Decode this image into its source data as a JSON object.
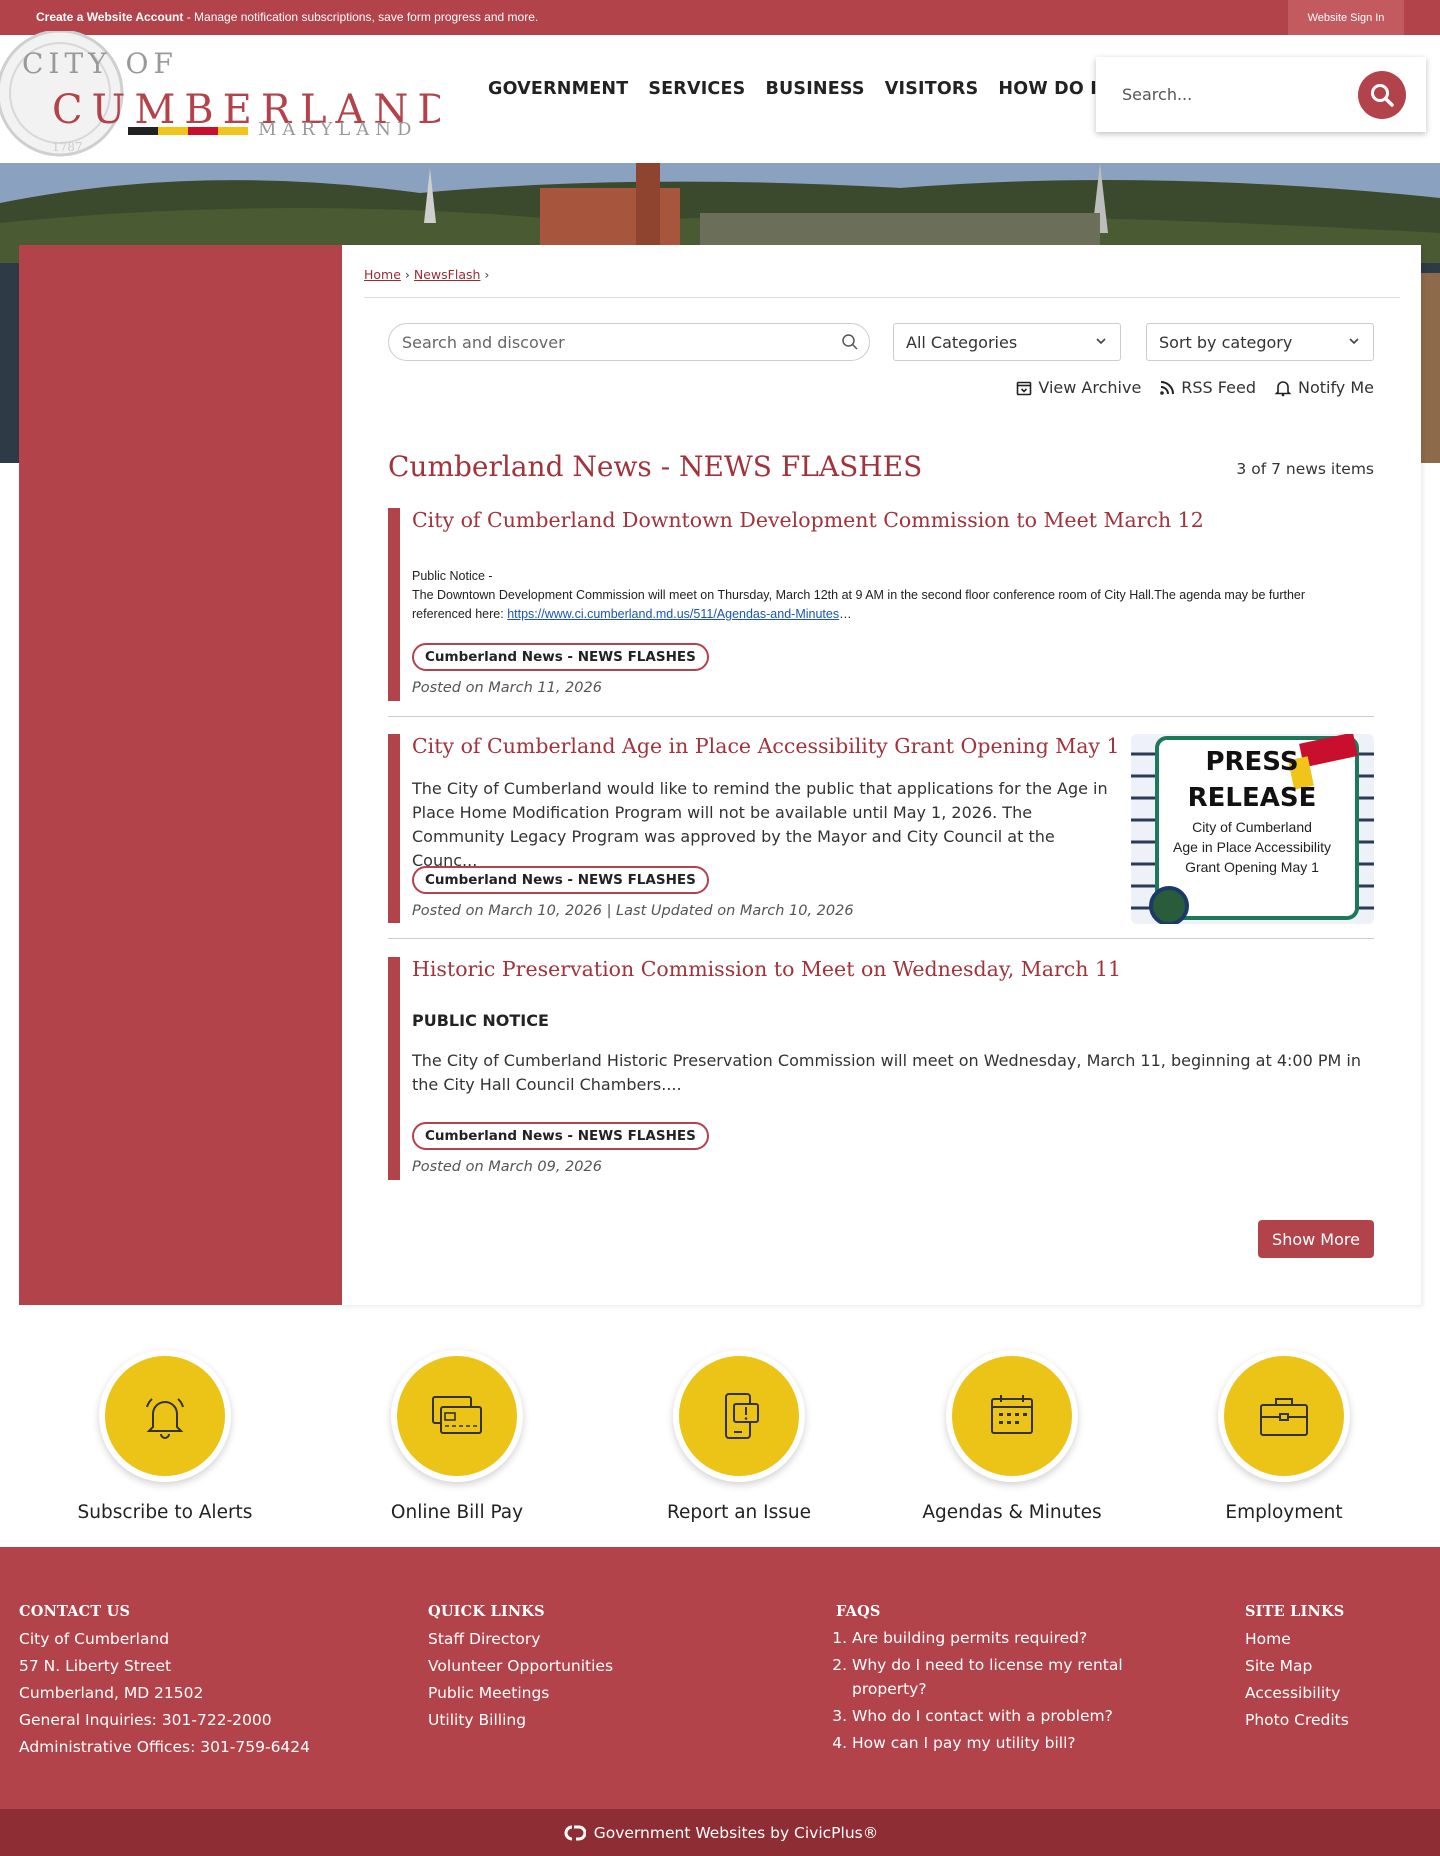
{
  "topbar": {
    "create_account": "Create a Website Account",
    "create_desc": " - Manage notification subscriptions, save form progress and more.",
    "sign_in": "Website Sign In"
  },
  "logo": {
    "city_of": "CITY OF",
    "cumberland": "CUMBERLAND",
    "maryland": "MARYLAND",
    "seal_year": "1787"
  },
  "nav": [
    "GOVERNMENT",
    "SERVICES",
    "BUSINESS",
    "VISITORS",
    "HOW DO I..."
  ],
  "search": {
    "placeholder": "Search..."
  },
  "breadcrumb": {
    "home": "Home",
    "newsflash": "NewsFlash"
  },
  "filters": {
    "search_placeholder": "Search and discover",
    "categories": "All Categories",
    "sort": "Sort by category"
  },
  "tools": {
    "archive": "View Archive",
    "rss": "RSS Feed",
    "notify": "Notify Me"
  },
  "section": {
    "title": "Cumberland News - NEWS FLASHES",
    "count": "3 of 7 news items"
  },
  "items": [
    {
      "title": "City of Cumberland Downtown Development Commission to Meet March 12",
      "line1": "Public Notice -",
      "line2": "The Downtown Development Commission will meet on Thursday, March 12th at 9 AM in the second floor conference room of City Hall.The agenda may be further",
      "line3_pre": "referenced here: ",
      "link": "https://www.ci.cumberland.md.us/511/Agendas-and-Minutes",
      "ellipsis": "…",
      "tag": "Cumberland News - NEWS FLASHES",
      "posted": "Posted on March 11, 2026"
    },
    {
      "title": "City of Cumberland Age in Place Accessibility Grant Opening May 1",
      "body": "The City of Cumberland would like to remind the public that applications for the Age in Place Home Modification Program will not be available until May 1, 2026. The Community Legacy Program was approved by the Mayor and City Council at the Counc...",
      "tag": "Cumberland News - NEWS FLASHES",
      "posted": "Posted on March 10, 2026 | Last Updated on March 10, 2026",
      "thumb": {
        "h1": "PRESS",
        "h2": "RELEASE",
        "l1": "City of Cumberland",
        "l2": "Age in Place Accessibility",
        "l3": "Grant Opening May 1"
      }
    },
    {
      "title": "Historic Preservation Commission to Meet on Wednesday, March 11",
      "heading": "PUBLIC NOTICE",
      "body": "The City of Cumberland Historic Preservation Commission will meet on Wednesday, March 11, beginning at 4:00 PM in the City Hall Council Chambers....",
      "tag": "Cumberland News - NEWS FLASHES",
      "posted": "Posted on March 09, 2026"
    }
  ],
  "show_more": "Show More",
  "quick_links": [
    "Subscribe to Alerts",
    "Online Bill Pay",
    "Report an Issue",
    "Agendas & Minutes",
    "Employment"
  ],
  "footer": {
    "contact": {
      "title": "CONTACT US",
      "lines": [
        "City of Cumberland",
        "57 N. Liberty Street",
        "Cumberland, MD 21502",
        "General Inquiries: 301-722-2000",
        "Administrative Offices: 301-759-6424"
      ]
    },
    "quick": {
      "title": "QUICK LINKS",
      "lines": [
        "Staff Directory",
        "Volunteer Opportunities",
        "Public Meetings",
        "Utility Billing"
      ]
    },
    "faqs": {
      "title": "FAQS",
      "lines": [
        "Are building permits required?",
        "Why do I need to license my rental property?",
        "Who do I contact with a problem?",
        "How can I pay my utility bill?"
      ]
    },
    "site": {
      "title": "SITE LINKS",
      "lines": [
        "Home",
        "Site Map",
        "Accessibility",
        "Photo Credits"
      ]
    },
    "bottom": "Government Websites by CivicPlus®"
  },
  "colors": {
    "brand": "#b3434a",
    "accent_yellow": "#ecc317",
    "dark": "#8e2e34"
  }
}
